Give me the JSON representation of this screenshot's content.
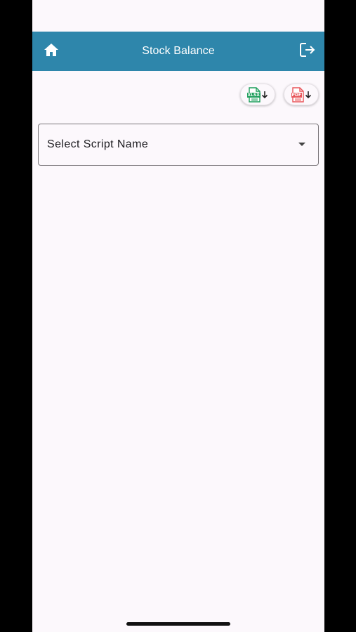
{
  "app_bar": {
    "title": "Stock Balance",
    "home_icon": "home-icon",
    "logout_icon": "logout-icon",
    "background_color": "#2E86AB"
  },
  "export": {
    "excel": {
      "badge": "XLSX",
      "icon": "xlsx-file-icon",
      "color": "#1D9E5B"
    },
    "pdf": {
      "badge": "PDF",
      "icon": "pdf-file-icon",
      "color": "#E8555A"
    }
  },
  "script_select": {
    "placeholder": "Select Script Name",
    "icon": "dropdown-caret-icon"
  }
}
